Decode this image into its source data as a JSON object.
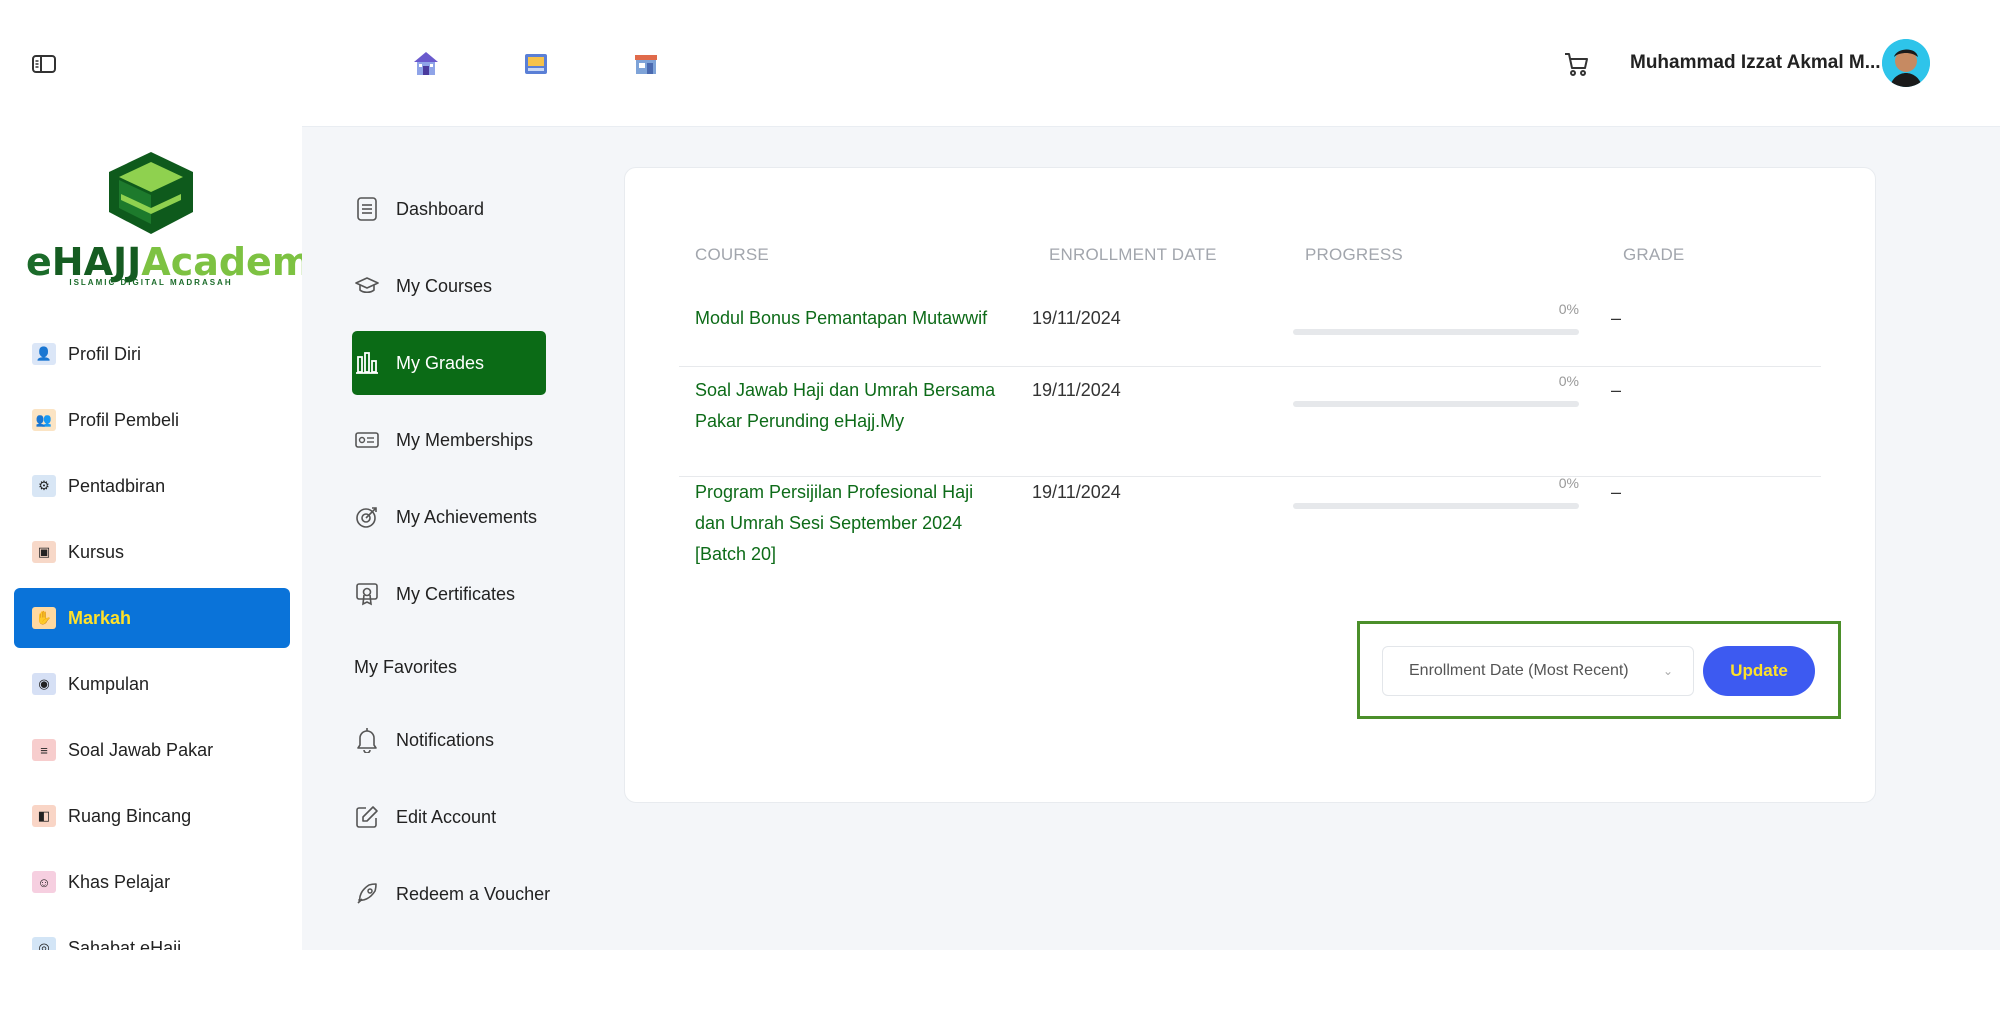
{
  "sidebar": {
    "logo": {
      "brand_e": "e",
      "brand_hajj": "HAJJ",
      "brand_academy": "Academy",
      "tagline": "ISLAMIC DIGITAL MADRASAH"
    },
    "items": [
      {
        "label": "Profil Diri",
        "icon": "person-icon",
        "color": "#6b8fd6"
      },
      {
        "label": "Profil Pembeli",
        "icon": "buyer-icon",
        "color": "#e0a040"
      },
      {
        "label": "Pentadbiran",
        "icon": "admin-icon",
        "color": "#7aa6d8"
      },
      {
        "label": "Kursus",
        "icon": "course-icon",
        "color": "#d9734a"
      },
      {
        "label": "Markah",
        "icon": "grades-icon",
        "color": "#f0a030"
      },
      {
        "label": "Kumpulan",
        "icon": "group-icon",
        "color": "#5b7ec9"
      },
      {
        "label": "Soal Jawab Pakar",
        "icon": "qa-icon",
        "color": "#d94a4a"
      },
      {
        "label": "Ruang Bincang",
        "icon": "discussion-icon",
        "color": "#e57b5a"
      },
      {
        "label": "Khas Pelajar",
        "icon": "student-icon",
        "color": "#d95a8a"
      },
      {
        "label": "Sahabat eHajj",
        "icon": "friends-icon",
        "color": "#5b9ed9"
      }
    ]
  },
  "topbar": {
    "username": "Muhammad Izzat Akmal M...",
    "icons": [
      "home-icon",
      "book-icon",
      "store-icon",
      "cart-icon"
    ]
  },
  "nav": {
    "items": [
      {
        "label": "Dashboard"
      },
      {
        "label": "My Courses"
      },
      {
        "label": "My Grades"
      },
      {
        "label": "My Memberships"
      },
      {
        "label": "My Achievements"
      },
      {
        "label": "My Certificates"
      },
      {
        "label": "My Favorites"
      },
      {
        "label": "Notifications"
      },
      {
        "label": "Edit Account"
      },
      {
        "label": "Redeem a Voucher"
      }
    ]
  },
  "grades": {
    "headers": {
      "course": "COURSE",
      "date": "ENROLLMENT DATE",
      "progress": "PROGRESS",
      "grade": "GRADE"
    },
    "rows": [
      {
        "course": "Modul Bonus Pemantapan Mutawwif",
        "date": "19/11/2024",
        "progress": "0%",
        "progress_value": 0,
        "grade": "–"
      },
      {
        "course": "Soal Jawab Haji dan Umrah Bersama Pakar Perunding eHajj.My",
        "date": "19/11/2024",
        "progress": "0%",
        "progress_value": 0,
        "grade": "–"
      },
      {
        "course": "Program Persijilan Profesional Haji dan Umrah Sesi September 2024 [Batch 20]",
        "date": "19/11/2024",
        "progress": "0%",
        "progress_value": 0,
        "grade": "–"
      }
    ],
    "sort": {
      "selected": "Enrollment Date (Most Recent)",
      "update_label": "Update"
    }
  },
  "colors": {
    "accent_green": "#0b6b16",
    "active_blue": "#0a73d9",
    "button_blue": "#3d5af1",
    "highlight_yellow": "#ffe12a"
  }
}
